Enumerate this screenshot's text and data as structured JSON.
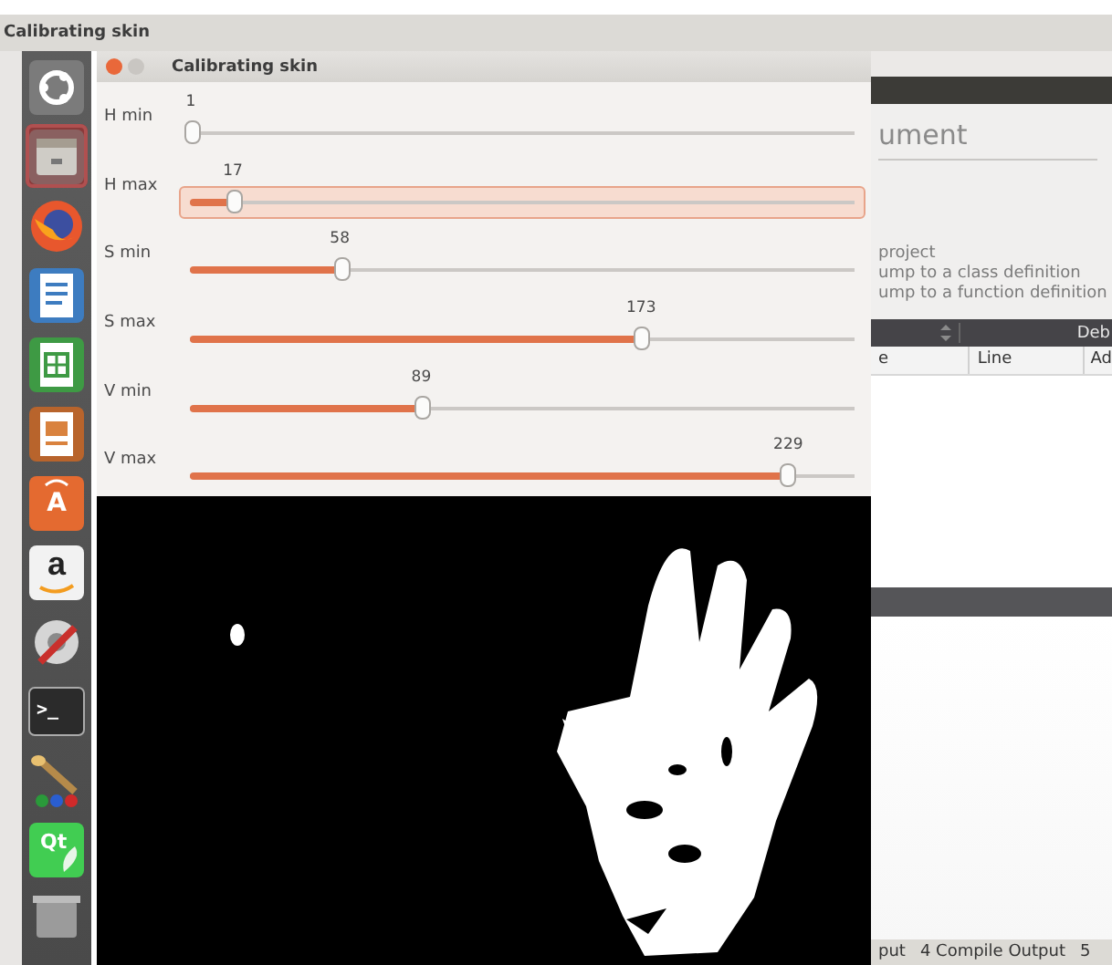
{
  "top_bar": {
    "title": "Calibrating skin"
  },
  "launcher": [
    {
      "kind": "ubuntu",
      "selected": false
    },
    {
      "kind": "files",
      "selected": true
    },
    {
      "kind": "firefox",
      "selected": false
    },
    {
      "kind": "writer",
      "selected": false
    },
    {
      "kind": "calc",
      "selected": false
    },
    {
      "kind": "impress",
      "selected": false
    },
    {
      "kind": "software",
      "selected": false,
      "glyph": "A"
    },
    {
      "kind": "amazon",
      "selected": false,
      "glyph": "a"
    },
    {
      "kind": "settings",
      "selected": false
    },
    {
      "kind": "terminal",
      "selected": false,
      "glyph": ">_"
    },
    {
      "kind": "paint",
      "selected": false
    },
    {
      "kind": "qt",
      "selected": false,
      "glyph": "Qt"
    },
    {
      "kind": "trash",
      "selected": false
    }
  ],
  "window": {
    "title": "Calibrating skin",
    "trackbars": [
      {
        "label": "H min",
        "value": "1",
        "level": 0.004,
        "focused": false
      },
      {
        "label": "H max",
        "value": "17",
        "level": 0.067,
        "focused": true
      },
      {
        "label": "S min",
        "value": "58",
        "level": 0.227,
        "focused": false
      },
      {
        "label": "S max",
        "value": "173",
        "level": 0.678,
        "focused": false
      },
      {
        "label": "V min",
        "value": "89",
        "level": 0.349,
        "focused": false
      },
      {
        "label": "V max",
        "value": "229",
        "level": 0.898,
        "focused": false
      }
    ]
  },
  "background_app": {
    "heading": "ument",
    "hints": [
      "project",
      "ump to a class definition",
      "ump to a function definition"
    ],
    "panel_title": "Deb",
    "columns": [
      "e",
      "Line",
      "Ad"
    ],
    "status_tabs": [
      "put",
      "4 Compile Output",
      "5"
    ]
  }
}
